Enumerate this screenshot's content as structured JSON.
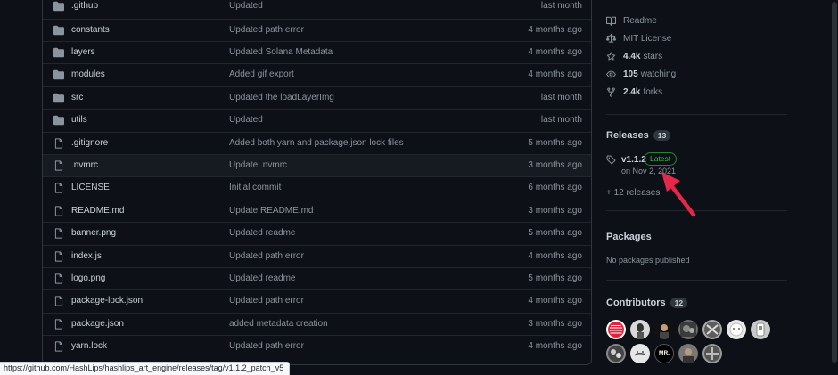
{
  "files": [
    {
      "name": ".github",
      "type": "folder",
      "message": "Updated",
      "time": "last month"
    },
    {
      "name": "constants",
      "type": "folder",
      "message": "Updated path error",
      "time": "4 months ago"
    },
    {
      "name": "layers",
      "type": "folder",
      "message": "Updated Solana Metadata",
      "time": "4 months ago"
    },
    {
      "name": "modules",
      "type": "folder",
      "message": "Added gif export",
      "time": "4 months ago"
    },
    {
      "name": "src",
      "type": "folder",
      "message": "Updated the loadLayerImg",
      "time": "last month"
    },
    {
      "name": "utils",
      "type": "folder",
      "message": "Updated",
      "time": "last month"
    },
    {
      "name": ".gitignore",
      "type": "file",
      "message": "Added both yarn and package.json lock files",
      "time": "5 months ago"
    },
    {
      "name": ".nvmrc",
      "type": "file",
      "message": "Update .nvmrc",
      "time": "3 months ago"
    },
    {
      "name": "LICENSE",
      "type": "file",
      "message": "Initial commit",
      "time": "6 months ago"
    },
    {
      "name": "README.md",
      "type": "file",
      "message": "Update README.md",
      "time": "3 months ago"
    },
    {
      "name": "banner.png",
      "type": "file",
      "message": "Updated readme",
      "time": "5 months ago"
    },
    {
      "name": "index.js",
      "type": "file",
      "message": "Updated path error",
      "time": "4 months ago"
    },
    {
      "name": "logo.png",
      "type": "file",
      "message": "Updated readme",
      "time": "5 months ago"
    },
    {
      "name": "package-lock.json",
      "type": "file",
      "message": "Updated path error",
      "time": "4 months ago"
    },
    {
      "name": "package.json",
      "type": "file",
      "message": "added metadata creation",
      "time": "3 months ago"
    },
    {
      "name": "yarn.lock",
      "type": "file",
      "message": "Updated path error",
      "time": "4 months ago"
    }
  ],
  "about": {
    "readme": "Readme",
    "license": "MIT License",
    "stars_value": "4.4k",
    "stars_label": "stars",
    "watching_value": "105",
    "watching_label": "watching",
    "forks_value": "2.4k",
    "forks_label": "forks"
  },
  "releases": {
    "title": "Releases",
    "count": "13",
    "latest_name": "v1.1.2",
    "latest_badge": "Latest",
    "latest_date": "on Nov 2, 2021",
    "more_link": "+ 12 releases"
  },
  "packages": {
    "title": "Packages",
    "empty_text": "No packages published"
  },
  "contributors": {
    "title": "Contributors",
    "count": "12",
    "avatar_label": "MR."
  },
  "status_bar": {
    "url": "https://github.com/HashLips/hashlips_art_engine/releases/tag/v1.1.2_patch_v5"
  },
  "colors": {
    "background": "#0d1117",
    "folder_icon": "#8b949e",
    "latest_badge": "#3fb950",
    "annotation_arrow": "#e5284a"
  },
  "highlighted_row": 7
}
